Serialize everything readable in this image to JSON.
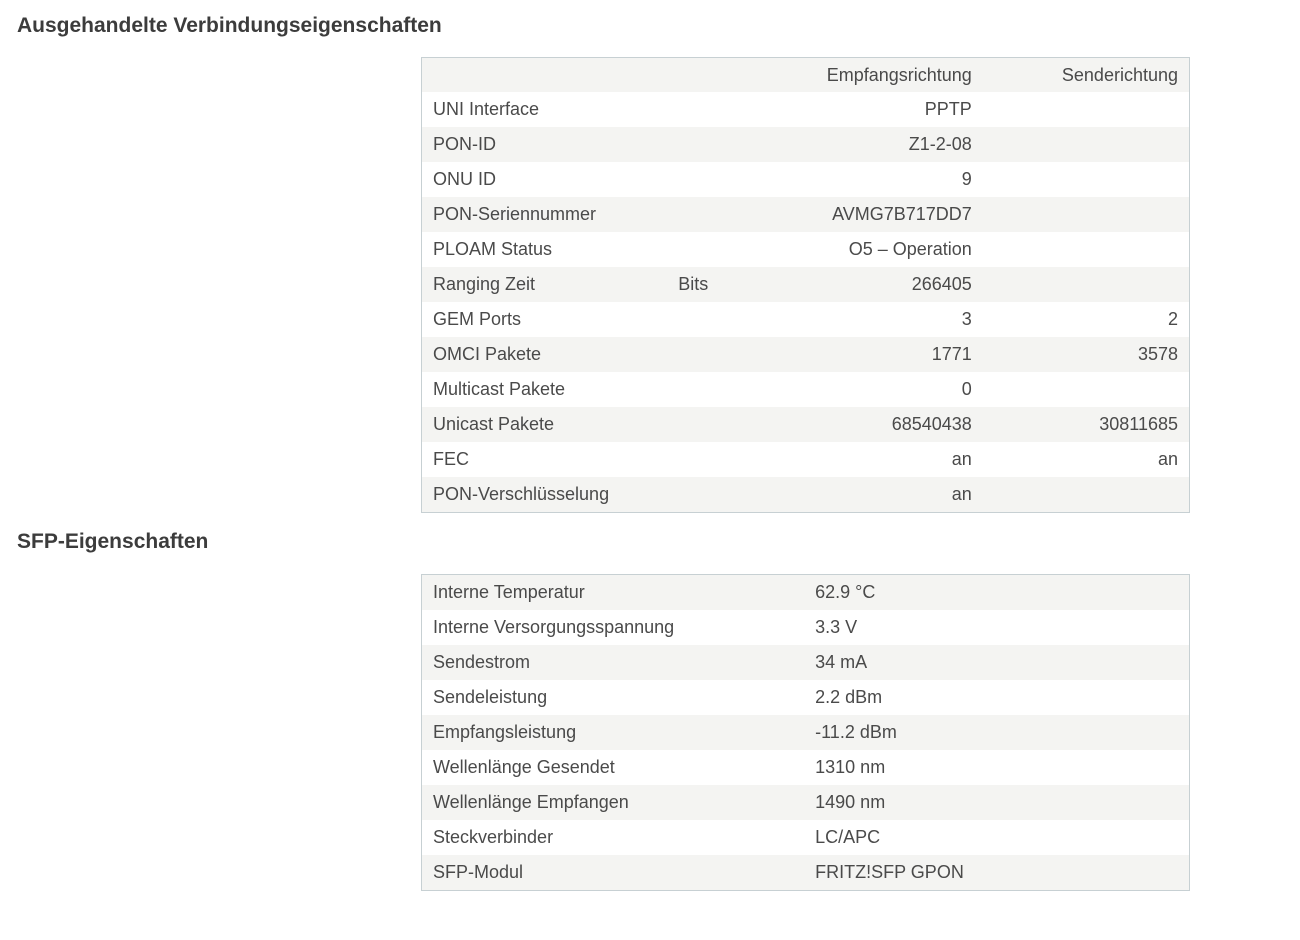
{
  "sections": {
    "connection": {
      "title": "Ausgehandelte Verbindungseigenschaften",
      "columns": [
        "",
        "",
        "Empfangsrichtung",
        "Senderichtung"
      ],
      "rows": [
        {
          "label": "UNI Interface",
          "unit": "",
          "rx": "PPTP",
          "tx": ""
        },
        {
          "label": "PON-ID",
          "unit": "",
          "rx": "Z1-2-08",
          "tx": ""
        },
        {
          "label": "ONU ID",
          "unit": "",
          "rx": "9",
          "tx": ""
        },
        {
          "label": "PON-Seriennummer",
          "unit": "",
          "rx": "AVMG7B717DD7",
          "tx": ""
        },
        {
          "label": "PLOAM Status",
          "unit": "",
          "rx": "O5 – Operation",
          "tx": ""
        },
        {
          "label": "Ranging Zeit",
          "unit": "Bits",
          "rx": "266405",
          "tx": ""
        },
        {
          "label": "GEM Ports",
          "unit": "",
          "rx": "3",
          "tx": "2"
        },
        {
          "label": "OMCI Pakete",
          "unit": "",
          "rx": "1771",
          "tx": "3578"
        },
        {
          "label": "Multicast Pakete",
          "unit": "",
          "rx": "0",
          "tx": ""
        },
        {
          "label": "Unicast Pakete",
          "unit": "",
          "rx": "68540438",
          "tx": "30811685"
        },
        {
          "label": "FEC",
          "unit": "",
          "rx": "an",
          "tx": "an"
        },
        {
          "label": "PON-Verschlüsselung",
          "unit": "",
          "rx": "an",
          "tx": ""
        }
      ]
    },
    "sfp": {
      "title": "SFP-Eigenschaften",
      "rows": [
        {
          "label": "Interne Temperatur",
          "value": "62.9 °C"
        },
        {
          "label": "Interne Versorgungsspannung",
          "value": "3.3 V"
        },
        {
          "label": "Sendestrom",
          "value": "34 mA"
        },
        {
          "label": "Sendeleistung",
          "value": "2.2 dBm"
        },
        {
          "label": "Empfangsleistung",
          "value": "-11.2 dBm"
        },
        {
          "label": "Wellenlänge Gesendet",
          "value": "1310 nm"
        },
        {
          "label": "Wellenlänge Empfangen",
          "value": "1490 nm"
        },
        {
          "label": "Steckverbinder",
          "value": "LC/APC"
        },
        {
          "label": "SFP-Modul",
          "value": "FRITZ!SFP GPON"
        }
      ]
    }
  }
}
